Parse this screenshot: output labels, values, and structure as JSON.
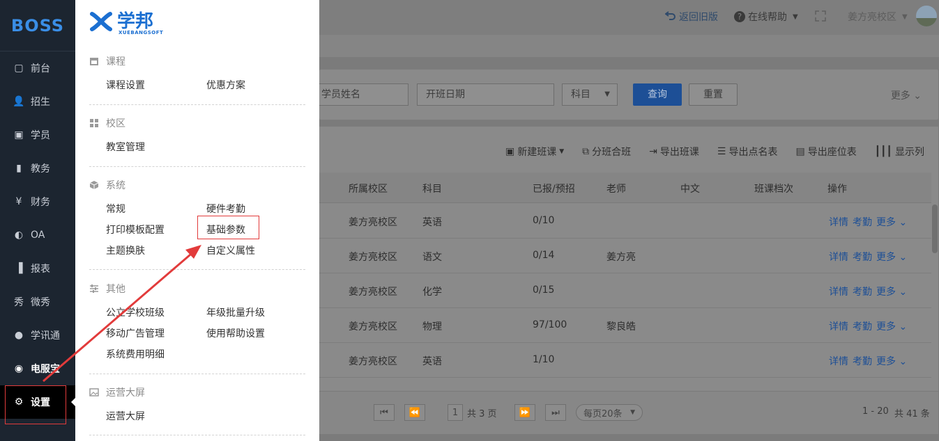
{
  "sidebar": {
    "logo": "BOSS",
    "items": [
      {
        "label": "前台",
        "icon": "calendar-icon"
      },
      {
        "label": "招生",
        "icon": "user-plus-icon"
      },
      {
        "label": "学员",
        "icon": "id-card-icon"
      },
      {
        "label": "教务",
        "icon": "book-icon"
      },
      {
        "label": "财务",
        "icon": "yen-icon"
      },
      {
        "label": "OA",
        "icon": "toggle-icon"
      },
      {
        "label": "报表",
        "icon": "bar-chart-icon"
      },
      {
        "label": "微秀",
        "icon": "xiu-icon"
      },
      {
        "label": "学讯通",
        "icon": "location-pin-icon"
      },
      {
        "label": "电服宝",
        "icon": "phone-service-icon"
      },
      {
        "label": "设置",
        "icon": "gear-icon"
      }
    ]
  },
  "topbar": {
    "back_old": "返回旧版",
    "help": "在线帮助",
    "campus": "姜方亮校区"
  },
  "filters": {
    "student_name_placeholder": "学员姓名",
    "start_date_placeholder": "开班日期",
    "subject": "科目",
    "query": "查询",
    "reset": "重置",
    "more": "更多"
  },
  "toolbar": {
    "new_class": "新建班课",
    "split_merge": "分班合班",
    "export_class": "导出班课",
    "export_roll": "导出点名表",
    "export_seat": "导出座位表",
    "show_columns": "显示列"
  },
  "table": {
    "headers": [
      "所属校区",
      "科目",
      "已报/预招",
      "老师",
      "中文",
      "班课档次",
      "操作"
    ],
    "rows": [
      {
        "campus": "姜方亮校区",
        "subject": "英语",
        "enrolled": "0/10",
        "teacher": ""
      },
      {
        "campus": "姜方亮校区",
        "subject": "语文",
        "enrolled": "0/14",
        "teacher": "姜方亮"
      },
      {
        "campus": "姜方亮校区",
        "subject": "化学",
        "enrolled": "0/15",
        "teacher": ""
      },
      {
        "campus": "姜方亮校区",
        "subject": "物理",
        "enrolled": "97/100",
        "teacher": "黎良皓"
      },
      {
        "campus": "姜方亮校区",
        "subject": "英语",
        "enrolled": "1/10",
        "teacher": ""
      }
    ],
    "actions": {
      "detail": "详情",
      "attendance": "考勤",
      "more": "更多"
    }
  },
  "pager": {
    "page": "1",
    "total_pages": "共 3 页",
    "per_page": "每页20条",
    "range": "1 - 20",
    "total": "共 41 条"
  },
  "menu": {
    "brand": "学邦",
    "brand_sub": "XUEBANGSOFT",
    "sections": [
      {
        "title": "课程",
        "links": [
          "课程设置",
          "优惠方案"
        ]
      },
      {
        "title": "校区",
        "links": [
          "教室管理"
        ]
      },
      {
        "title": "系统",
        "links": [
          "常规",
          "硬件考勤",
          "打印模板配置",
          "基础参数",
          "主题换肤",
          "自定义属性"
        ]
      },
      {
        "title": "其他",
        "links": [
          "公立学校班级",
          "年级批量升级",
          "移动广告管理",
          "使用帮助设置",
          "系统费用明细"
        ]
      },
      {
        "title": "运营大屏",
        "links": [
          "运营大屏"
        ]
      }
    ]
  },
  "colors": {
    "accent": "#1b6fd1",
    "sidebar_bg": "#1c2530",
    "highlight": "#e23b3b"
  }
}
